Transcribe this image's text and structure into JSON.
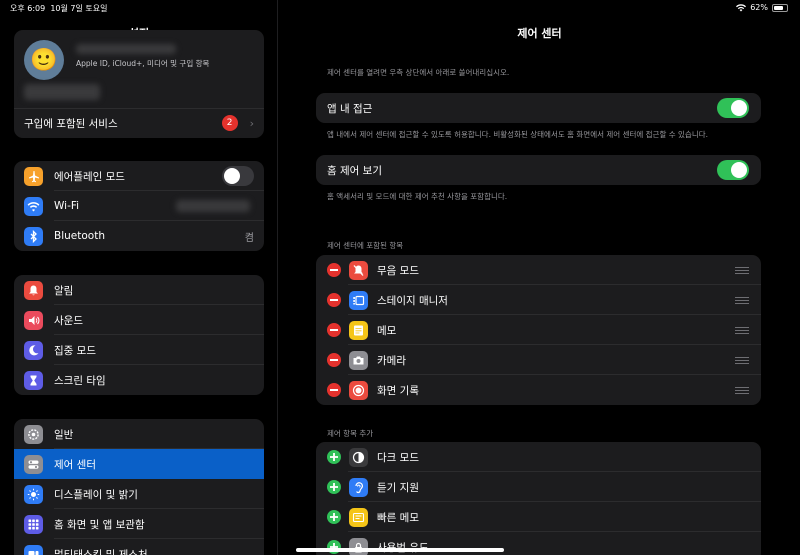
{
  "status_bar": {
    "time": "오후 6:09",
    "date": "10월 7일 토요일",
    "battery": "62%",
    "battery_level": 0.62
  },
  "sidebar": {
    "title": "설정",
    "profile_sub": "Apple ID, iCloud+, 미디어 및 구입 항목",
    "services_label": "구입에 포함된 서비스",
    "services_badge": "2",
    "connectivity": [
      {
        "label": "에어플레인 모드",
        "icon": "airplane-icon",
        "color": "#f7a12b",
        "toggle": false
      },
      {
        "label": "Wi-Fi",
        "icon": "wifi-icon",
        "color": "#2f7cf6",
        "value": ""
      },
      {
        "label": "Bluetooth",
        "icon": "bluetooth-icon",
        "color": "#2f7cf6",
        "value": "켬"
      }
    ],
    "notifications": [
      {
        "label": "알림",
        "icon": "bell-icon",
        "color": "#eb4b3f"
      },
      {
        "label": "사운드",
        "icon": "speaker-icon",
        "color": "#eb4b5d"
      },
      {
        "label": "집중 모드",
        "icon": "moon-icon",
        "color": "#5e5ce6"
      },
      {
        "label": "스크린 타임",
        "icon": "hourglass-icon",
        "color": "#5e5ce6"
      }
    ],
    "general": [
      {
        "label": "일반",
        "icon": "gear-icon",
        "color": "#8e8e93"
      },
      {
        "label": "제어 센터",
        "icon": "switches-icon",
        "color": "#8e8e93",
        "selected": true
      },
      {
        "label": "디스플레이 및 밝기",
        "icon": "sun-icon",
        "color": "#2f7cf6"
      },
      {
        "label": "홈 화면 및 앱 보관함",
        "icon": "grid-icon",
        "color": "#5e5ce6"
      },
      {
        "label": "멀티태스킹 및 제스처",
        "icon": "multitask-icon",
        "color": "#2f7cf6"
      }
    ]
  },
  "detail": {
    "title": "제어 센터",
    "intro": "제어 센터를 열려면 우측 상단에서 아래로 쓸어내리십시오.",
    "in_app": {
      "label": "앱 내 접근",
      "on": true,
      "caption": "앱 내에서 제어 센터에 접근할 수 있도록 허용합니다. 비활성화된 상태에서도 홈 화면에서 제어 센터에 접근할 수 있습니다."
    },
    "home_controls": {
      "label": "홈 제어 보기",
      "on": true,
      "caption": "홈 액세서리 및 모드에 대한 제어 추천 사항을 포함합니다."
    },
    "included_header": "제어 센터에 포함된 항목",
    "included": [
      {
        "label": "무음 모드",
        "icon": "bell-slash-icon",
        "color": "#eb4b3f"
      },
      {
        "label": "스테이지 매니저",
        "icon": "stage-manager-icon",
        "color": "#2f7cf6"
      },
      {
        "label": "메모",
        "icon": "notes-icon",
        "color": "#f5c518"
      },
      {
        "label": "카메라",
        "icon": "camera-icon",
        "color": "#8e8e93"
      },
      {
        "label": "화면 기록",
        "icon": "record-icon",
        "color": "#eb4b3f"
      }
    ],
    "more_header": "제어 항목 추가",
    "more": [
      {
        "label": "다크 모드",
        "icon": "dark-mode-icon",
        "color": "#3a3a3c"
      },
      {
        "label": "듣기 지원",
        "icon": "ear-icon",
        "color": "#2f7cf6"
      },
      {
        "label": "빠른 메모",
        "icon": "quick-note-icon",
        "color": "#f5c518"
      },
      {
        "label": "사용법 유도",
        "icon": "lock-icon",
        "color": "#8e8e93"
      }
    ]
  }
}
